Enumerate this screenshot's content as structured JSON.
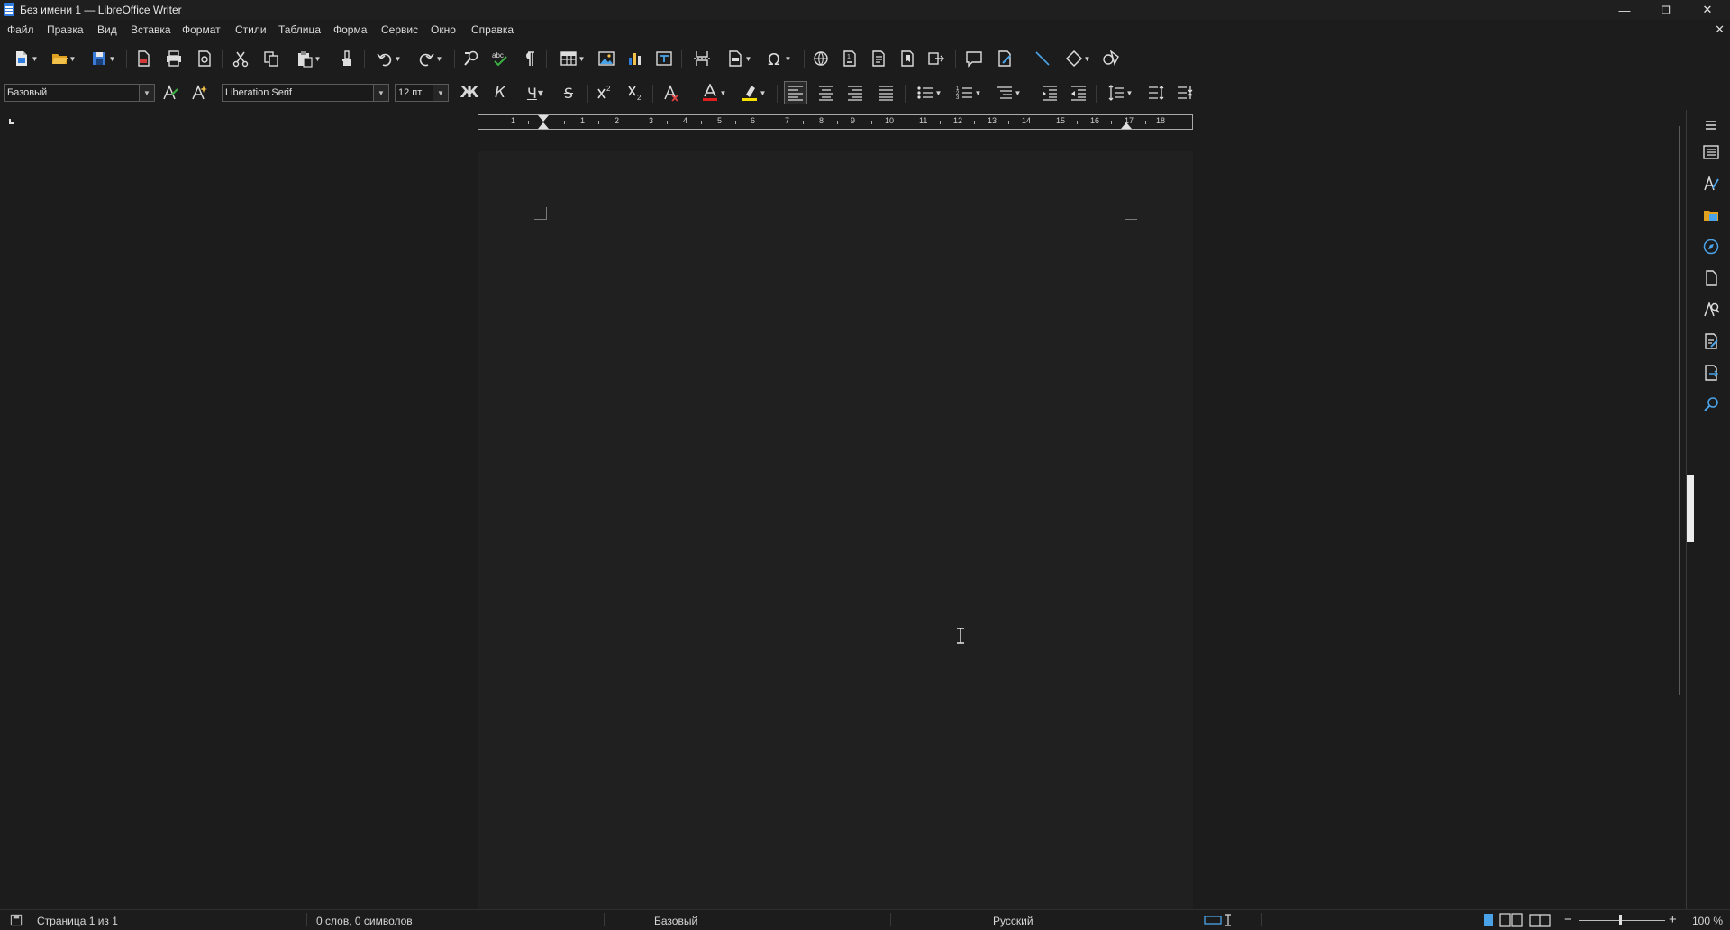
{
  "window": {
    "title": "Без имени 1 — LibreOffice Writer",
    "minimize": "—",
    "maximize": "❐",
    "close": "✕"
  },
  "menu": {
    "items": [
      {
        "label": "Файл"
      },
      {
        "label": "Правка"
      },
      {
        "label": "Вид"
      },
      {
        "label": "Вставка"
      },
      {
        "label": "Формат"
      },
      {
        "label": "Стили"
      },
      {
        "label": "Таблица"
      },
      {
        "label": "Форма"
      },
      {
        "label": "Сервис"
      },
      {
        "label": "Окно"
      },
      {
        "label": "Справка"
      }
    ],
    "doc_close": "✕"
  },
  "formatting": {
    "paragraph_style": "Базовый",
    "font_name": "Liberation Serif",
    "font_size": "12 пт",
    "bold_label": "Ж",
    "italic_label": "К",
    "underline_label": "Ч",
    "strike_label": "S",
    "font_color": "#e02020",
    "highlight_color": "#f5e000"
  },
  "ruler": {
    "numbers": [
      "1",
      "1",
      "2",
      "3",
      "4",
      "5",
      "6",
      "7",
      "8",
      "9",
      "10",
      "11",
      "12",
      "13",
      "14",
      "15",
      "16",
      "17",
      "18"
    ]
  },
  "status": {
    "page": "Страница 1 из 1",
    "words": "0 слов, 0 символов",
    "style": "Базовый",
    "language": "Русский",
    "zoom": "100 %",
    "zoom_minus": "−",
    "zoom_plus": "+"
  },
  "colors": {
    "background": "#1c1c1c",
    "page": "#202020",
    "accent": "#2f7de1"
  }
}
